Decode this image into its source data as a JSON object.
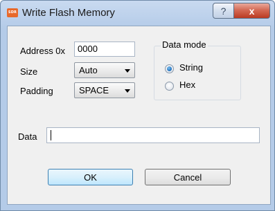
{
  "window": {
    "title": "Write Flash Memory",
    "app_icon_text": "SDR",
    "help_glyph": "?",
    "close_glyph": "x"
  },
  "form": {
    "address_label": "Address 0x",
    "address_value": "0000",
    "size_label": "Size",
    "size_value": "Auto",
    "padding_label": "Padding",
    "padding_value": "SPACE",
    "data_label": "Data",
    "data_value": ""
  },
  "data_mode": {
    "title": "Data mode",
    "options": [
      {
        "label": "String",
        "checked": true
      },
      {
        "label": "Hex",
        "checked": false
      }
    ]
  },
  "buttons": {
    "ok": "OK",
    "cancel": "Cancel"
  }
}
